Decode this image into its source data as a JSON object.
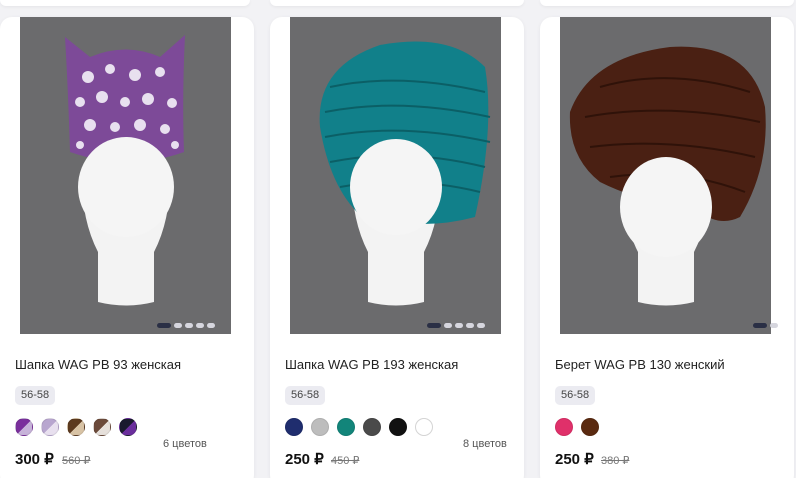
{
  "products": [
    {
      "title": "Шапка WAG PB 93 женская",
      "size": "56-58",
      "swatches": [
        "#7a2f9c",
        "#b8a6cf",
        "#5c3a1f",
        "#6b4a3a",
        "#1a1a2e"
      ],
      "colors_label": "6 цветов",
      "price": "300 ₽",
      "old_price": "560 ₽",
      "hat_color": "#7d4a98",
      "image_dots": 5,
      "active_dot": 0
    },
    {
      "title": "Шапка WAG PB 193 женская",
      "size": "56-58",
      "swatches": [
        "#1f2d6e",
        "#bdbdbd",
        "#12857a",
        "#4a4a4a",
        "#111111",
        "#ffffff"
      ],
      "colors_label": "8 цветов",
      "price": "250 ₽",
      "old_price": "450 ₽",
      "hat_color": "#11808a",
      "image_dots": 5,
      "active_dot": 0
    },
    {
      "title": "Берет WAG PB 130 женский",
      "size": "56-58",
      "swatches": [
        "#e0306a",
        "#5a2a10"
      ],
      "colors_label": "",
      "price": "250 ₽",
      "old_price": "380 ₽",
      "hat_color": "#4a2013",
      "image_dots": 2,
      "active_dot": 0
    }
  ]
}
